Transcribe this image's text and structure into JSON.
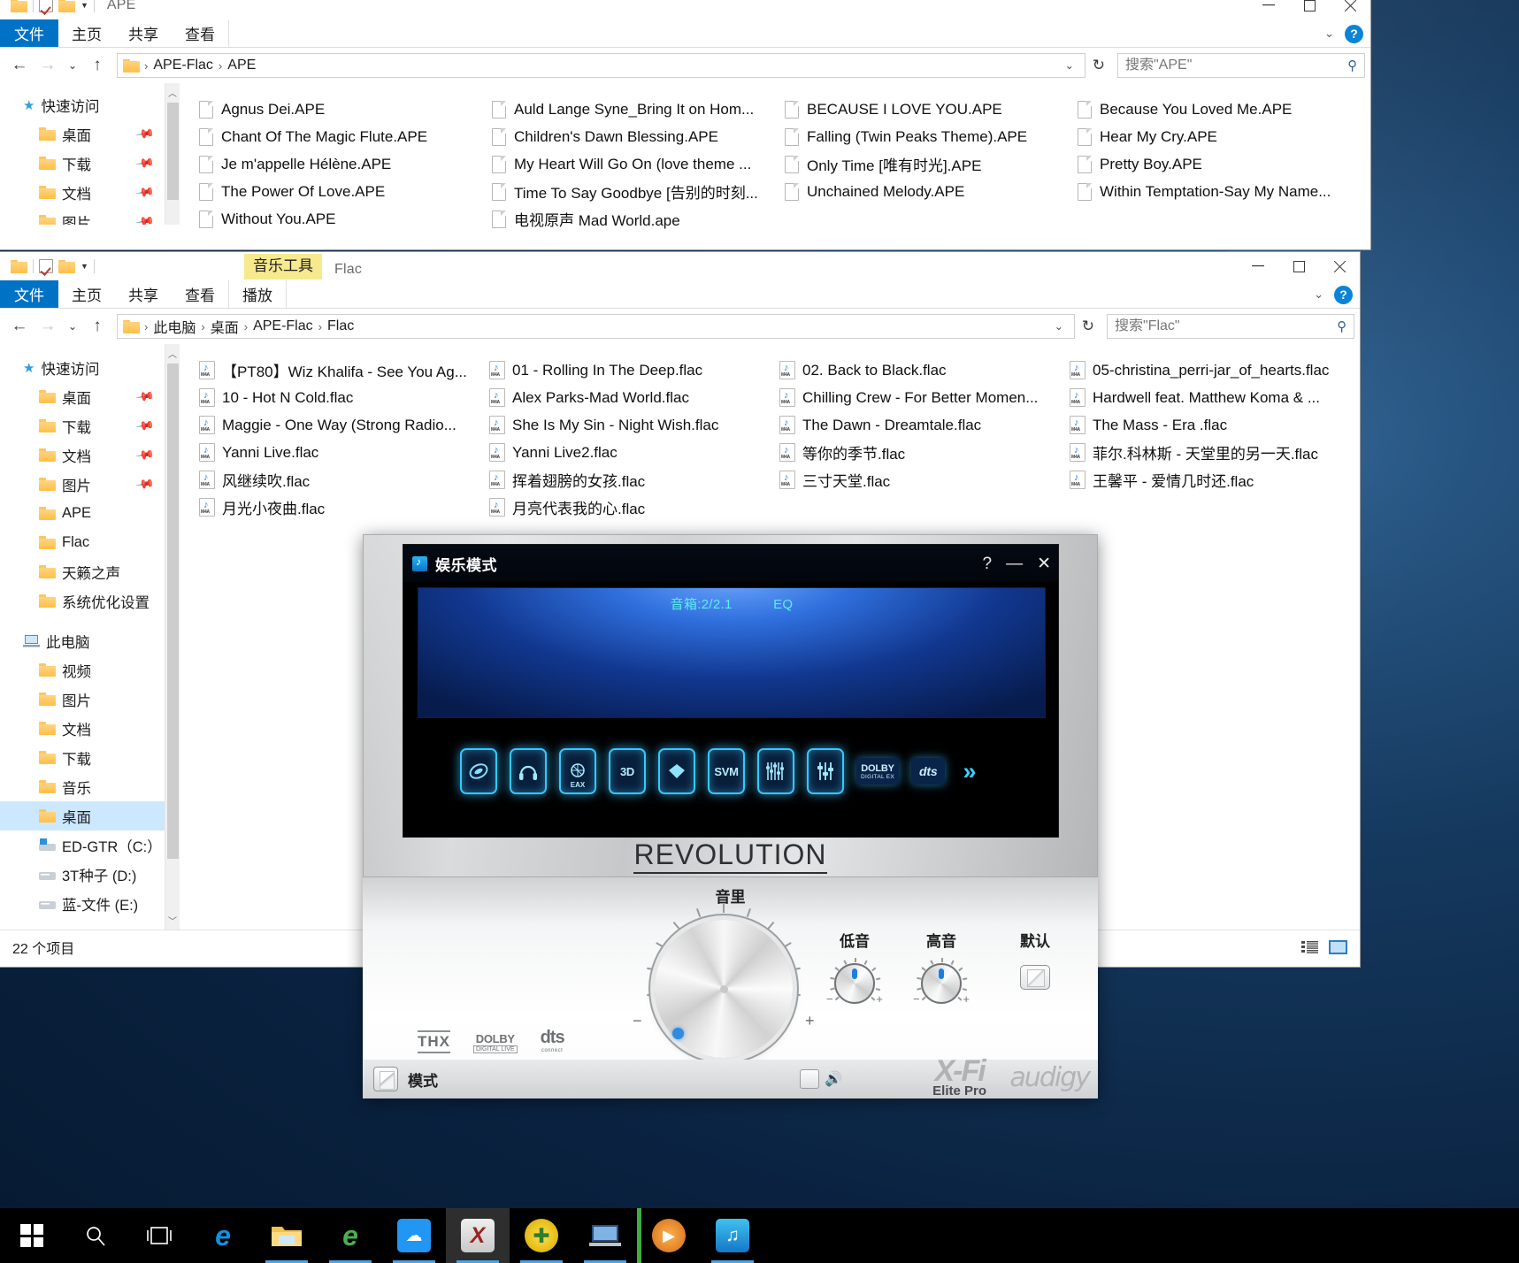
{
  "desktop": {
    "background_color": "#0d2b4a"
  },
  "window_ape": {
    "caption": "APE",
    "quick_access_icons": [
      "folder-icon",
      "properties-checkbox-icon",
      "new-folder-icon",
      "customize-caret-icon"
    ],
    "ribbon": {
      "file": "文件",
      "tabs": [
        "主页",
        "共享",
        "查看"
      ]
    },
    "window_controls": {
      "minimize": "—",
      "maximize": "□",
      "close": "✕"
    },
    "address": {
      "crumbs": [
        "APE-Flac",
        "APE"
      ]
    },
    "search": {
      "placeholder": "搜索\"APE\"",
      "value": ""
    },
    "nav_pane": [
      {
        "label": "快速访问",
        "icon": "star-icon",
        "level": "root",
        "pinned": false
      },
      {
        "label": "桌面",
        "icon": "desktop-folder-icon",
        "level": "child",
        "pinned": true
      },
      {
        "label": "下载",
        "icon": "downloads-folder-icon",
        "level": "child",
        "pinned": true
      },
      {
        "label": "文档",
        "icon": "documents-folder-icon",
        "level": "child",
        "pinned": true
      },
      {
        "label": "图片",
        "icon": "pictures-folder-icon",
        "level": "child",
        "pinned": true
      }
    ],
    "files": [
      "Agnus Dei.APE",
      "Auld Lange Syne_Bring It on Hom...",
      "BECAUSE I LOVE YOU.APE",
      "Because You Loved Me.APE",
      "Chant Of The Magic Flute.APE",
      "Children's Dawn Blessing.APE",
      "Falling (Twin Peaks Theme).APE",
      "Hear My Cry.APE",
      "Je m'appelle Hélène.APE",
      "My Heart Will Go On (love theme ...",
      "Only Time [唯有时光].APE",
      "Pretty Boy.APE",
      "The Power Of Love.APE",
      "Time To Say Goodbye [告别的时刻...",
      "Unchained Melody.APE",
      "Within Temptation-Say My Name...",
      "Without You.APE",
      "电视原声 Mad World.ape"
    ]
  },
  "window_flac": {
    "caption": "Flac",
    "contextual_tab_group": "音乐工具",
    "ribbon": {
      "file": "文件",
      "tabs": [
        "主页",
        "共享",
        "查看"
      ],
      "contextual_tab": "播放"
    },
    "window_controls": {
      "minimize": "—",
      "maximize": "□",
      "close": "✕"
    },
    "address": {
      "crumbs": [
        "此电脑",
        "桌面",
        "APE-Flac",
        "Flac"
      ]
    },
    "search": {
      "placeholder": "搜索\"Flac\"",
      "value": ""
    },
    "nav_pane": [
      {
        "label": "快速访问",
        "icon": "star-icon",
        "level": "root",
        "pinned": false,
        "selected": false
      },
      {
        "label": "桌面",
        "icon": "desktop-folder-icon",
        "level": "child",
        "pinned": true,
        "selected": false
      },
      {
        "label": "下载",
        "icon": "downloads-folder-icon",
        "level": "child",
        "pinned": true,
        "selected": false
      },
      {
        "label": "文档",
        "icon": "documents-folder-icon",
        "level": "child",
        "pinned": true,
        "selected": false
      },
      {
        "label": "图片",
        "icon": "pictures-folder-icon",
        "level": "child",
        "pinned": true,
        "selected": false
      },
      {
        "label": "APE",
        "icon": "folder-icon",
        "level": "child",
        "pinned": false,
        "selected": false
      },
      {
        "label": "Flac",
        "icon": "folder-icon",
        "level": "child",
        "pinned": false,
        "selected": false
      },
      {
        "label": "天籁之声",
        "icon": "folder-icon",
        "level": "child",
        "pinned": false,
        "selected": false
      },
      {
        "label": "系统优化设置",
        "icon": "folder-icon",
        "level": "child",
        "pinned": false,
        "selected": false
      },
      {
        "label": "此电脑",
        "icon": "this-pc-icon",
        "level": "root",
        "pinned": false,
        "selected": false,
        "gap_before": true
      },
      {
        "label": "视频",
        "icon": "videos-folder-icon",
        "level": "child",
        "pinned": false,
        "selected": false
      },
      {
        "label": "图片",
        "icon": "pictures-folder-icon",
        "level": "child",
        "pinned": false,
        "selected": false
      },
      {
        "label": "文档",
        "icon": "documents-folder-icon",
        "level": "child",
        "pinned": false,
        "selected": false
      },
      {
        "label": "下载",
        "icon": "downloads-folder-icon",
        "level": "child",
        "pinned": false,
        "selected": false
      },
      {
        "label": "音乐",
        "icon": "music-folder-icon",
        "level": "child",
        "pinned": false,
        "selected": false
      },
      {
        "label": "桌面",
        "icon": "desktop-folder-icon",
        "level": "child",
        "pinned": false,
        "selected": true
      },
      {
        "label": "ED-GTR（C:）",
        "icon": "system-drive-icon",
        "level": "child",
        "pinned": false,
        "selected": false
      },
      {
        "label": "3T种子 (D:)",
        "icon": "drive-icon",
        "level": "child",
        "pinned": false,
        "selected": false
      },
      {
        "label": "蓝-文件 (E:)",
        "icon": "drive-icon",
        "level": "child",
        "pinned": false,
        "selected": false
      }
    ],
    "files": [
      "【PT80】Wiz Khalifa - See You Ag...",
      "01 - Rolling In The Deep.flac",
      "02. Back to Black.flac",
      "05-christina_perri-jar_of_hearts.flac",
      "10 - Hot N Cold.flac",
      "Alex Parks-Mad World.flac",
      "Chilling Crew - For Better Momen...",
      "Hardwell feat. Matthew Koma & ...",
      "Maggie - One Way (Strong Radio...",
      "She Is My Sin - Night Wish.flac",
      "The Dawn - Dreamtale.flac",
      "The Mass - Era .flac",
      "Yanni Live.flac",
      "Yanni Live2.flac",
      "等你的季节.flac",
      "菲尔.科林斯 - 天堂里的另一天.flac",
      "风继续吹.flac",
      "挥着翅膀的女孩.flac",
      "三寸天堂.flac",
      "王馨平 - 爱情几时还.flac",
      "月光小夜曲.flac",
      "月亮代表我的心.flac"
    ],
    "status": {
      "item_count": "22 个项目"
    },
    "view_toggles": [
      "details-view-icon",
      "large-icons-view-icon"
    ]
  },
  "xfi_panel": {
    "title": "娱乐模式",
    "title_icon": "xfi-app-icon",
    "title_buttons": {
      "help": "?",
      "minimize": "—",
      "close": "✕"
    },
    "lcd": {
      "speaker_label": "音箱:2/2.1",
      "eq_label": "EQ"
    },
    "effect_buttons": [
      {
        "name": "crystalizer-icon",
        "label": ""
      },
      {
        "name": "headphone-icon",
        "label": ""
      },
      {
        "name": "eax-icon",
        "label": "EAX"
      },
      {
        "name": "cmss3d-icon",
        "label": "3D"
      },
      {
        "name": "crystal-icon",
        "label": ""
      },
      {
        "name": "svm-icon",
        "label": "SVM"
      },
      {
        "name": "graphic-eq-icon",
        "label": ""
      },
      {
        "name": "mixer-icon",
        "label": ""
      }
    ],
    "badges": [
      {
        "name": "dolby-digital-ex-badge",
        "line1": "DOLBY",
        "line2": "DIGITAL EX"
      },
      {
        "name": "dts-badge",
        "line1": "dts",
        "line2": ""
      }
    ],
    "more_chevron": "»",
    "brand_text": "REVOLUTION",
    "volume": {
      "label": "音里",
      "minus": "−",
      "plus": "+"
    },
    "bass": {
      "label": "低音",
      "minus": "−",
      "plus": "+"
    },
    "treble": {
      "label": "高音",
      "minus": "−",
      "plus": "+"
    },
    "default": {
      "label": "默认"
    },
    "footer": {
      "mode_label": "模式",
      "mute_icon": "mute-checkbox",
      "speaker_icon": "speaker-icon"
    },
    "logos": {
      "thx": "THX",
      "dolby_line1": "DOLBY",
      "dolby_line2": "DIGITAL LIVE",
      "dts_line1": "dts",
      "dts_line2": "connect",
      "xfi_line1": "X-Fi",
      "xfi_line2": "Elite Pro",
      "audigy": "audigy"
    }
  },
  "taskbar": {
    "items": [
      {
        "name": "start-button",
        "icon": "windows-logo-icon",
        "color": "#ffffff"
      },
      {
        "name": "search-button",
        "icon": "search-icon",
        "color": "#ffffff"
      },
      {
        "name": "task-view-button",
        "icon": "task-view-icon",
        "color": "#ffffff"
      },
      {
        "name": "edge-button",
        "icon": "edge-icon",
        "color": "#0f7ec8"
      },
      {
        "name": "file-explorer-button",
        "icon": "file-explorer-icon",
        "color": "#f5c452"
      },
      {
        "name": "ie-button",
        "icon": "internet-explorer-icon",
        "color": "#4caf50"
      },
      {
        "name": "baidu-netdisk-button",
        "icon": "cloud-disk-icon",
        "color": "#2196f3"
      },
      {
        "name": "xfi-panel-button",
        "icon": "creative-xfi-icon",
        "color": "#b03030"
      },
      {
        "name": "security-button",
        "icon": "shield-plus-icon",
        "color": "#ffd100"
      },
      {
        "name": "remote-button",
        "icon": "remote-desktop-icon",
        "color": "#3b6ea5"
      },
      {
        "name": "media-player-button",
        "icon": "media-player-icon",
        "color": "#e07818"
      },
      {
        "name": "music-app-button",
        "icon": "music-note-icon",
        "color": "#2aa8e0"
      }
    ]
  }
}
